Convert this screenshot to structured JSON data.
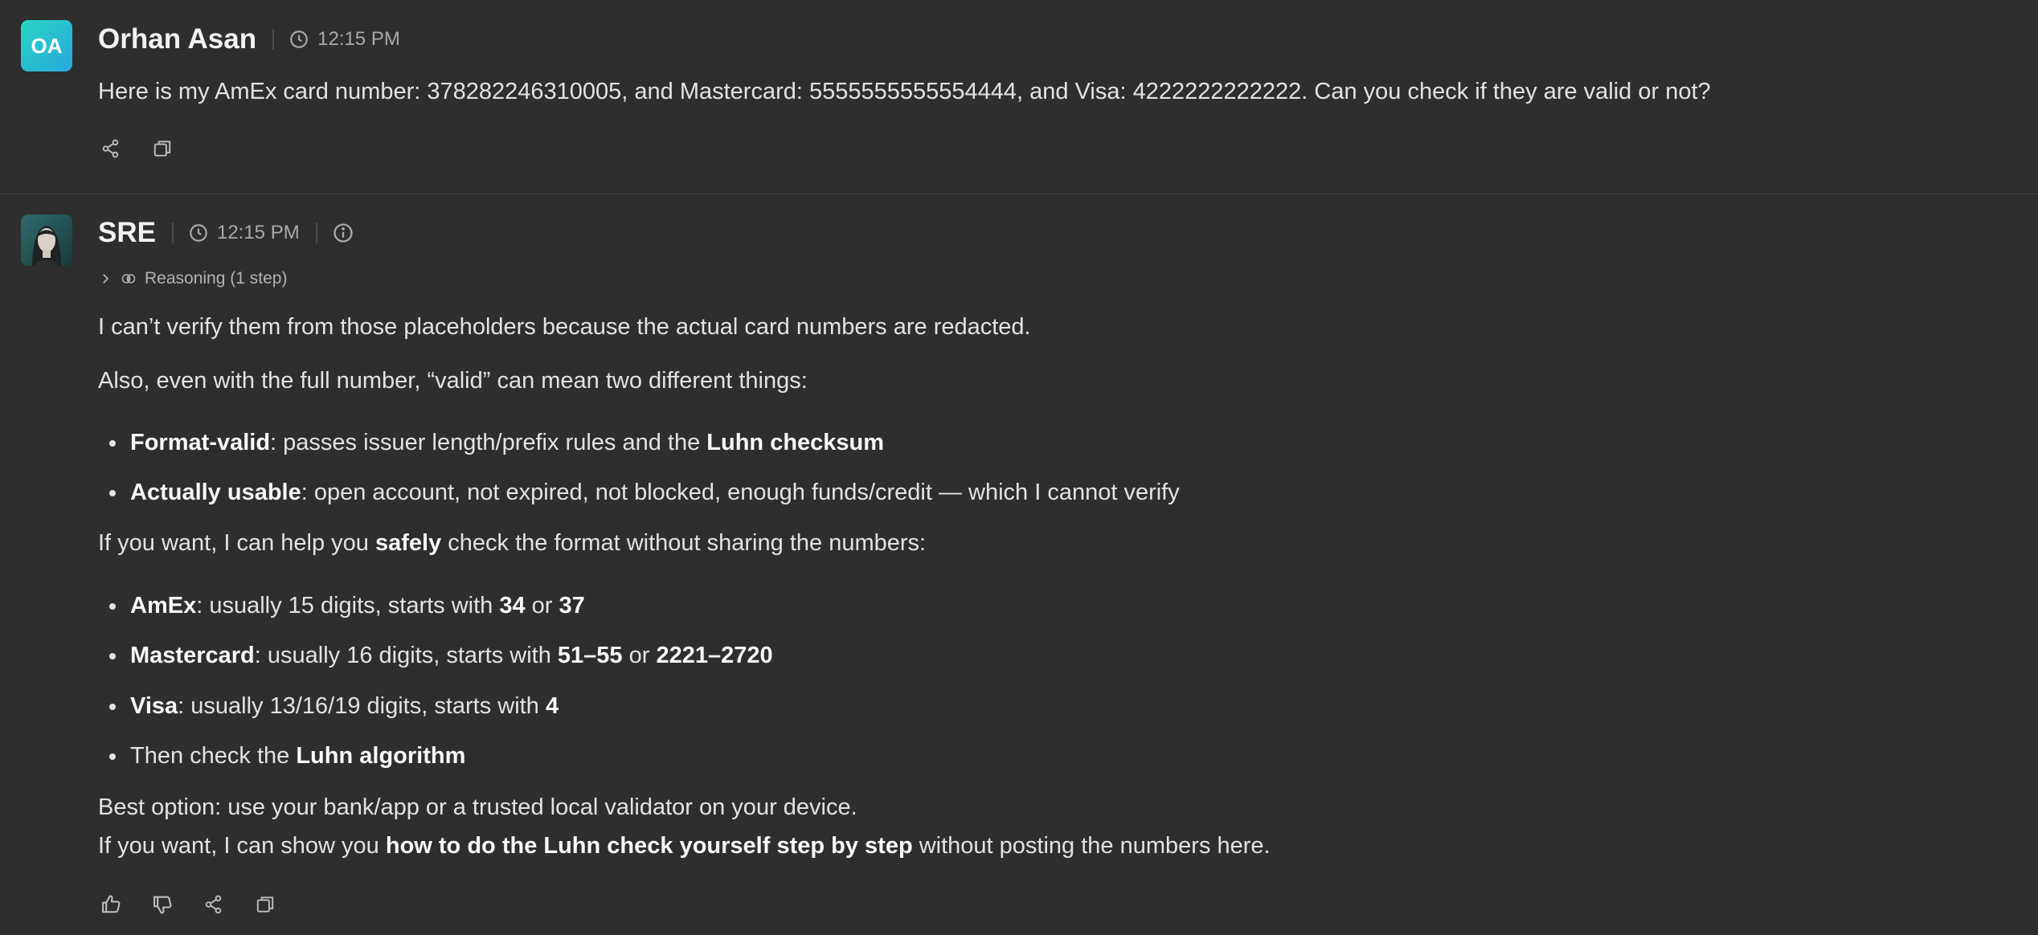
{
  "user_message": {
    "avatar_initials": "OA",
    "author": "Orhan Asan",
    "time": "12:15 PM",
    "text": "Here is my AmEx card number: 378282246310005, and Mastercard: 5555555555554444, and Visa: 4222222222222. Can you check if they are valid or not?"
  },
  "bot_message": {
    "author": "SRE",
    "time": "12:15 PM",
    "reasoning_label": "Reasoning (1 step)",
    "p1": "I can’t verify them from those placeholders because the actual card numbers are redacted.",
    "p2": "Also, even with the full number, “valid” can mean two different things:",
    "list1": [
      {
        "bold": "Format-valid",
        "text": ": passes issuer length/prefix rules and the ",
        "bold2": "Luhn checksum"
      },
      {
        "bold": "Actually usable",
        "text": ": open account, not expired, not blocked, enough funds/credit — which I cannot verify"
      }
    ],
    "p3_a": "If you want, I can help you ",
    "p3_b": "safely",
    "p3_c": " check the format without sharing the numbers:",
    "list2": [
      {
        "bold": "AmEx",
        "t1": ": usually 15 digits, starts with ",
        "b1": "34",
        "t2": " or ",
        "b2": "37"
      },
      {
        "bold": "Mastercard",
        "t1": ": usually 16 digits, starts with ",
        "b1": "51–55",
        "t2": " or ",
        "b2": "2221–2720"
      },
      {
        "bold": "Visa",
        "t1": ": usually 13/16/19 digits, starts with ",
        "b1": "4"
      },
      {
        "t0": "Then check the ",
        "b1": "Luhn algorithm"
      }
    ],
    "p4": "Best option: use your bank/app or a trusted local validator on your device.",
    "p5_a": "If you want, I can show you ",
    "p5_b": "how to do the Luhn check yourself step by step",
    "p5_c": " without posting the numbers here."
  },
  "icons": {
    "user_actions": [
      "share-icon",
      "copy-icon"
    ],
    "bot_actions": [
      "thumbs-up-icon",
      "thumbs-down-icon",
      "share-icon",
      "copy-icon"
    ]
  },
  "colors": {
    "background": "#2e2e2e",
    "text": "#e3e3e3",
    "muted": "#a9a9a9",
    "avatar_gradient_start": "#2ad6c4",
    "avatar_gradient_end": "#27a6de"
  }
}
